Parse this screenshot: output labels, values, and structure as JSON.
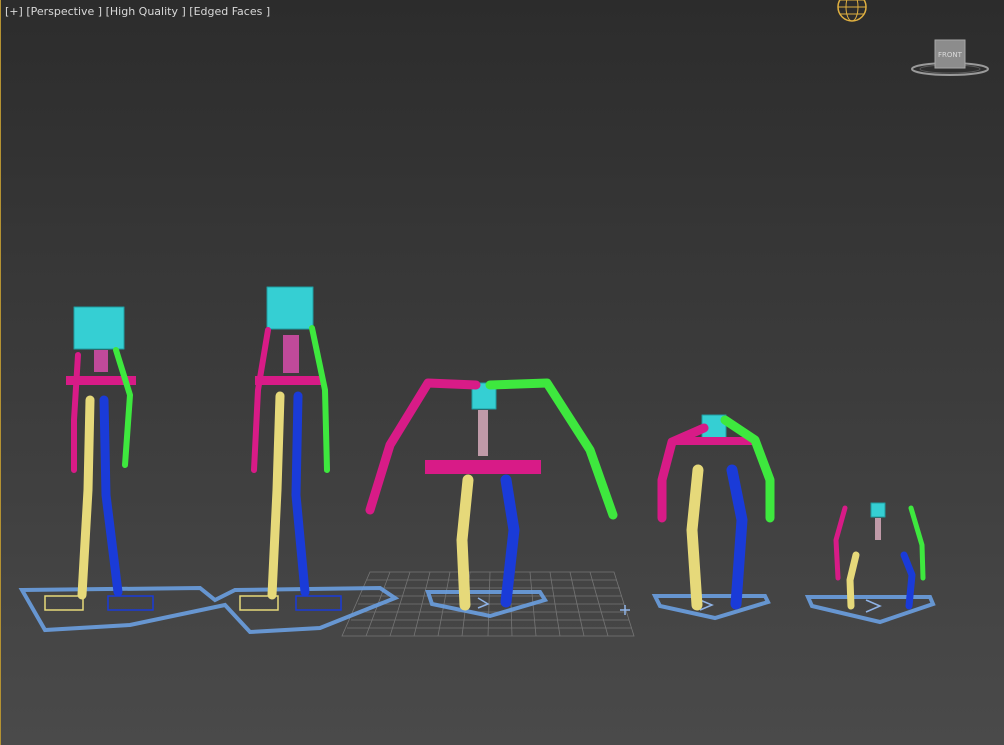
{
  "viewport": {
    "labels": {
      "menu": "[+]",
      "view": "[Perspective ]",
      "quality": "[High Quality ]",
      "shading": "[Edged Faces ]"
    },
    "viewcube": {
      "face": "FRONT"
    }
  },
  "colors": {
    "head": "#35cfd3",
    "spine": "#d81b87",
    "left_limbs": "#d81b87",
    "right_arm": "#3ee83e",
    "left_leg": "#e6d97a",
    "right_leg": "#1a3bd8",
    "footsteps": "#5a8fd6",
    "grid": "#8a8a8a"
  },
  "scene": {
    "objects": [
      "biped-1",
      "biped-2",
      "biped-3",
      "biped-4",
      "biped-5"
    ]
  }
}
